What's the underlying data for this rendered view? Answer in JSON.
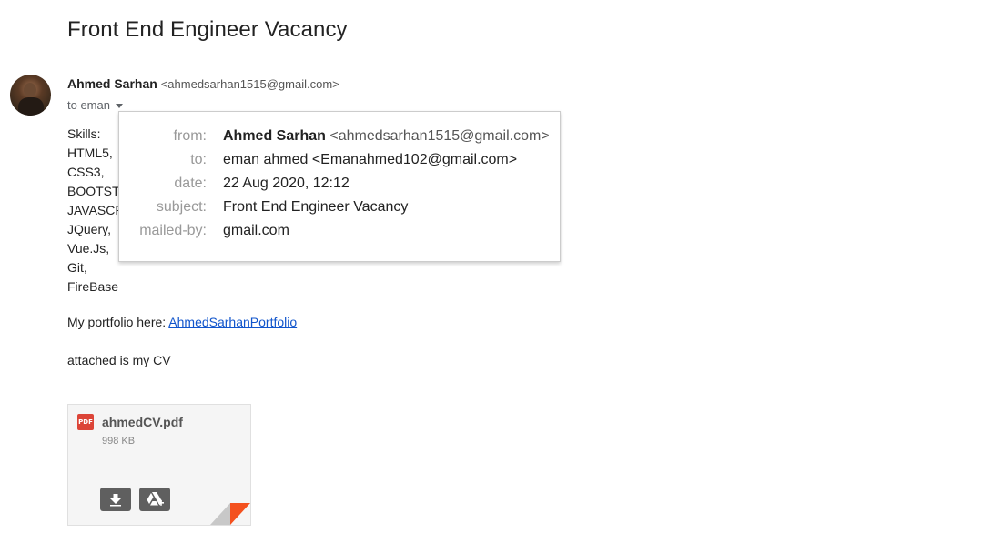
{
  "email": {
    "subject": "Front End Engineer Vacancy",
    "sender": {
      "name": "Ahmed Sarhan",
      "email": "<ahmedsarhan1515@gmail.com>"
    },
    "to_line": "to eman",
    "body": {
      "skills_lines": [
        "Skills:",
        "HTML5,",
        "CSS3,",
        "BOOTSTRAP,",
        "JAVASCRIPT,",
        "JQuery,",
        "Vue.Js,",
        "Git,",
        "FireBase"
      ],
      "portfolio_prefix": "My portfolio here: ",
      "portfolio_link": "AhmedSarhanPortfolio",
      "attached_text": "attached is my CV"
    },
    "attachment": {
      "type_label": "PDF",
      "file_name": "ahmedCV.pdf",
      "file_size": "998 KB",
      "buttons": [
        "download-icon",
        "add-to-drive-icon"
      ]
    }
  },
  "details_popup": {
    "from_label": "from:",
    "from_name": "Ahmed Sarhan",
    "from_email": "<ahmedsarhan1515@gmail.com>",
    "to_label": "to:",
    "to_value": "eman ahmed <Emanahmed102@gmail.com>",
    "date_label": "date:",
    "date_value": "22 Aug 2020, 12:12",
    "subject_label": "subject:",
    "subject_value": "Front End Engineer Vacancy",
    "mailedby_label": "mailed-by:",
    "mailedby_value": "gmail.com"
  },
  "colors": {
    "link": "#1155cc",
    "pdf_red": "#dc4437",
    "fold_orange": "#f4511e",
    "label_gray": "#999999"
  }
}
